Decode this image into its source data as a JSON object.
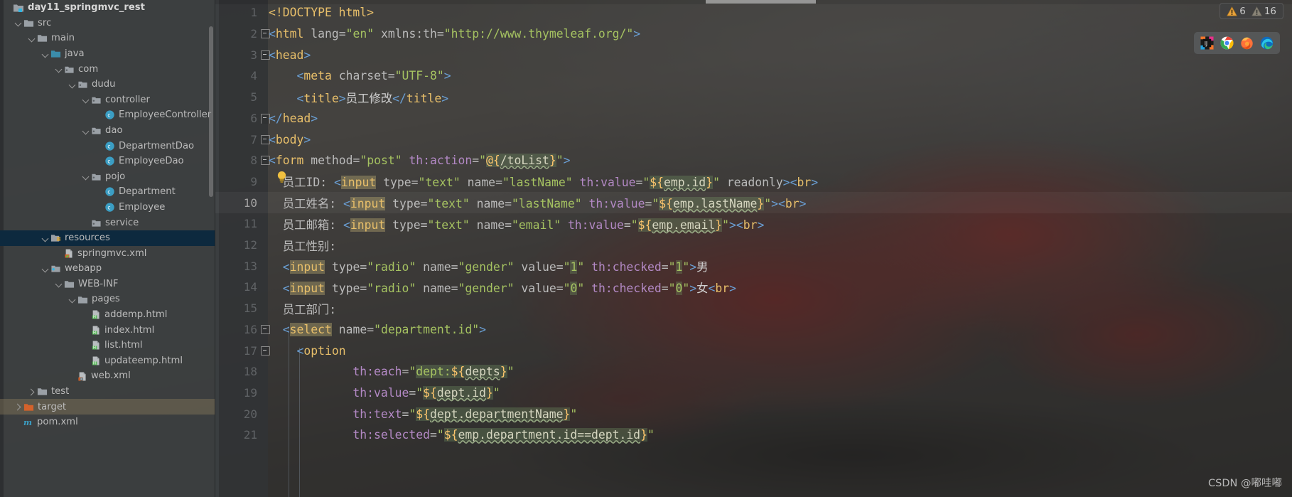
{
  "project": {
    "root_label": "day11_springmvc_rest",
    "items": [
      {
        "label": "day11_springmvc_rest",
        "depth": 0,
        "icon": "module-icon",
        "chevron": "none",
        "state": "normal",
        "bold": true
      },
      {
        "label": "src",
        "depth": 1,
        "icon": "folder-icon",
        "chevron": "down",
        "state": "normal"
      },
      {
        "label": "main",
        "depth": 2,
        "icon": "folder-icon",
        "chevron": "down",
        "state": "normal"
      },
      {
        "label": "java",
        "depth": 3,
        "icon": "source-root-icon",
        "chevron": "down",
        "state": "normal"
      },
      {
        "label": "com",
        "depth": 4,
        "icon": "package-icon",
        "chevron": "down",
        "state": "normal"
      },
      {
        "label": "dudu",
        "depth": 5,
        "icon": "package-icon",
        "chevron": "down",
        "state": "normal"
      },
      {
        "label": "controller",
        "depth": 6,
        "icon": "package-icon",
        "chevron": "down",
        "state": "normal"
      },
      {
        "label": "EmployeeController",
        "depth": 7,
        "icon": "java-class-icon",
        "chevron": "none",
        "state": "normal"
      },
      {
        "label": "dao",
        "depth": 6,
        "icon": "package-icon",
        "chevron": "down",
        "state": "normal"
      },
      {
        "label": "DepartmentDao",
        "depth": 7,
        "icon": "java-class-icon",
        "chevron": "none",
        "state": "normal"
      },
      {
        "label": "EmployeeDao",
        "depth": 7,
        "icon": "java-class-icon",
        "chevron": "none",
        "state": "normal"
      },
      {
        "label": "pojo",
        "depth": 6,
        "icon": "package-icon",
        "chevron": "down",
        "state": "normal"
      },
      {
        "label": "Department",
        "depth": 7,
        "icon": "java-class-icon",
        "chevron": "none",
        "state": "normal"
      },
      {
        "label": "Employee",
        "depth": 7,
        "icon": "java-class-icon",
        "chevron": "none",
        "state": "normal"
      },
      {
        "label": "service",
        "depth": 6,
        "icon": "package-icon",
        "chevron": "none",
        "state": "normal"
      },
      {
        "label": "resources",
        "depth": 3,
        "icon": "resource-root-icon",
        "chevron": "down",
        "state": "selected"
      },
      {
        "label": "springmvc.xml",
        "depth": 4,
        "icon": "spring-xml-icon",
        "chevron": "none",
        "state": "normal"
      },
      {
        "label": "webapp",
        "depth": 3,
        "icon": "webapp-icon",
        "chevron": "down",
        "state": "normal"
      },
      {
        "label": "WEB-INF",
        "depth": 4,
        "icon": "folder-icon",
        "chevron": "down",
        "state": "normal"
      },
      {
        "label": "pages",
        "depth": 5,
        "icon": "folder-icon",
        "chevron": "down",
        "state": "normal"
      },
      {
        "label": "addemp.html",
        "depth": 6,
        "icon": "html-file-icon",
        "chevron": "none",
        "state": "normal"
      },
      {
        "label": "index.html",
        "depth": 6,
        "icon": "html-file-icon",
        "chevron": "none",
        "state": "normal"
      },
      {
        "label": "list.html",
        "depth": 6,
        "icon": "html-file-icon",
        "chevron": "none",
        "state": "normal"
      },
      {
        "label": "updateemp.html",
        "depth": 6,
        "icon": "html-file-icon",
        "chevron": "none",
        "state": "normal"
      },
      {
        "label": "web.xml",
        "depth": 5,
        "icon": "web-xml-icon",
        "chevron": "none",
        "state": "normal"
      },
      {
        "label": "test",
        "depth": 2,
        "icon": "folder-icon",
        "chevron": "right",
        "state": "normal"
      },
      {
        "label": "target",
        "depth": 1,
        "icon": "excluded-folder-icon",
        "chevron": "right",
        "state": "hover"
      },
      {
        "label": "pom.xml",
        "depth": 1,
        "icon": "maven-icon",
        "chevron": "none",
        "state": "normal"
      }
    ]
  },
  "editor": {
    "lines": [
      {
        "num": "1",
        "fold": "none"
      },
      {
        "num": "2",
        "fold": "open"
      },
      {
        "num": "3",
        "fold": "open"
      },
      {
        "num": "4",
        "fold": "none"
      },
      {
        "num": "5",
        "fold": "none"
      },
      {
        "num": "6",
        "fold": "close"
      },
      {
        "num": "7",
        "fold": "open"
      },
      {
        "num": "8",
        "fold": "open"
      },
      {
        "num": "9",
        "fold": "none"
      },
      {
        "num": "10",
        "fold": "none",
        "caret": true
      },
      {
        "num": "11",
        "fold": "none"
      },
      {
        "num": "12",
        "fold": "none"
      },
      {
        "num": "13",
        "fold": "none"
      },
      {
        "num": "14",
        "fold": "none"
      },
      {
        "num": "15",
        "fold": "none"
      },
      {
        "num": "16",
        "fold": "open"
      },
      {
        "num": "17",
        "fold": "open"
      },
      {
        "num": "18",
        "fold": "none"
      },
      {
        "num": "19",
        "fold": "none"
      },
      {
        "num": "20",
        "fold": "none"
      },
      {
        "num": "21",
        "fold": "none"
      }
    ],
    "code_text": [
      "<!DOCTYPE html>",
      "<html lang=\"en\" xmlns:th=\"http://www.thymeleaf.org/\">",
      "<head>",
      "    <meta charset=\"UTF-8\">",
      "    <title>员工修改</title>",
      "</head>",
      "<body>",
      "<form method=\"post\" th:action=\"@{/toList}\">",
      "  员工ID: <input type=\"text\" name=\"lastName\" th:value=\"${emp.id}\" readonly><br>",
      "  员工姓名: <input type=\"text\" name=\"lastName\" th:value=\"${emp.lastName}\"><br>",
      "  员工邮箱: <input type=\"text\" name=\"email\" th:value=\"${emp.email}\"><br>",
      "  员工性别:",
      "  <input type=\"radio\" name=\"gender\" value=\"1\" th:checked=\"1\">男",
      "  <input type=\"radio\" name=\"gender\" value=\"0\" th:checked=\"0\">女<br>",
      "  员工部门:",
      "  <select name=\"department.id\">",
      "    <option",
      "            th:each=\"dept:${depts}\"",
      "            th:value=\"${dept.id}\"",
      "            th:text=\"${dept.departmentName}\"",
      "            th:selected=\"${emp.department.id==dept.id}\""
    ],
    "intention_bulb": "intention-bulb-icon"
  },
  "inspection": {
    "warning_count": "6",
    "weak_warning_count": "16",
    "warning_icon": "warning-triangle-icon",
    "weak_warning_icon": "weak-warning-triangle-icon"
  },
  "browsers": [
    {
      "name": "intellij-idea-icon"
    },
    {
      "name": "google-chrome-icon"
    },
    {
      "name": "firefox-icon"
    },
    {
      "name": "microsoft-edge-icon"
    }
  ],
  "watermark": {
    "text": "CSDN @嘟哇嘟"
  },
  "colors": {
    "selection_blue": "#0d293e",
    "accent_yellow": "#e8bf6a",
    "attr_value_green": "#a5c261",
    "th_attr_purple": "#b389c5",
    "tag_blue": "#6a9fd4"
  }
}
